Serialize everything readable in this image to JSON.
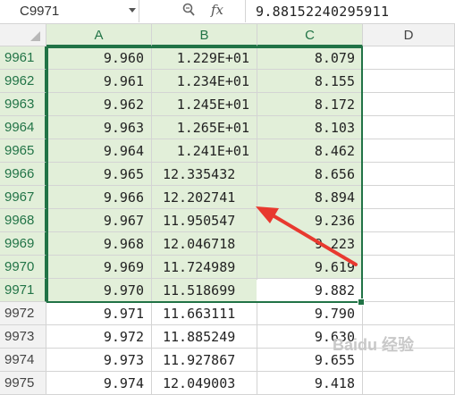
{
  "formula_bar": {
    "name_box": "C9971",
    "zoom_icon": "magnifier-icon",
    "fx_label": "fx",
    "formula": "9.88152240295911"
  },
  "columns": [
    "A",
    "B",
    "C",
    "D"
  ],
  "selected_columns": [
    "A",
    "B",
    "C"
  ],
  "rows": [
    {
      "num": "9961",
      "a": "9.960",
      "b": "1.229E+01",
      "c": "8.079"
    },
    {
      "num": "9962",
      "a": "9.961",
      "b": "1.234E+01",
      "c": "8.155"
    },
    {
      "num": "9963",
      "a": "9.962",
      "b": "1.245E+01",
      "c": "8.172"
    },
    {
      "num": "9964",
      "a": "9.963",
      "b": "1.265E+01",
      "c": "8.103"
    },
    {
      "num": "9965",
      "a": "9.964",
      "b": "1.241E+01",
      "c": "8.462"
    },
    {
      "num": "9966",
      "a": "9.965",
      "b": "12.335432",
      "c": "8.656"
    },
    {
      "num": "9967",
      "a": "9.966",
      "b": "12.202741",
      "c": "8.894"
    },
    {
      "num": "9968",
      "a": "9.967",
      "b": "11.950547",
      "c": "9.236"
    },
    {
      "num": "9969",
      "a": "9.968",
      "b": "12.046718",
      "c": "9.223"
    },
    {
      "num": "9970",
      "a": "9.969",
      "b": "11.724989",
      "c": "9.619"
    },
    {
      "num": "9971",
      "a": "9.970",
      "b": "11.518699",
      "c": "9.882"
    },
    {
      "num": "9972",
      "a": "9.971",
      "b": "11.663111",
      "c": "9.790"
    },
    {
      "num": "9973",
      "a": "9.972",
      "b": "11.885249",
      "c": "9.630"
    },
    {
      "num": "9974",
      "a": "9.973",
      "b": "11.927867",
      "c": "9.655"
    },
    {
      "num": "9975",
      "a": "9.974",
      "b": "12.049003",
      "c": "9.418"
    }
  ],
  "selected_rows": [
    "9961",
    "9962",
    "9963",
    "9964",
    "9965",
    "9966",
    "9967",
    "9968",
    "9969",
    "9970",
    "9971"
  ],
  "watermark": "Baidu 经验",
  "colors": {
    "selection": "#217346",
    "selection_fill": "#e2efd9",
    "arrow": "#e8392f"
  }
}
